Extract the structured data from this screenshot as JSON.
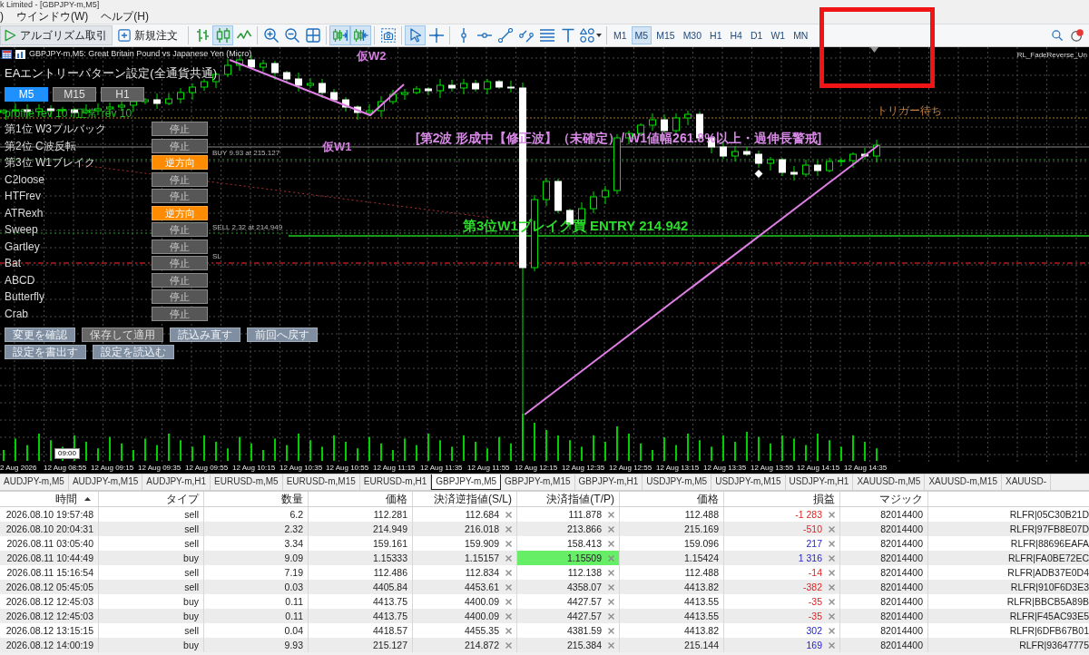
{
  "window": {
    "title": "k Limited - [GBPJPY-m,M5]"
  },
  "menu": [
    ")",
    "ウインドウ(W)",
    "ヘルプ(H)"
  ],
  "toolbar": {
    "buttons": [
      {
        "kind": "algo",
        "label": "アルゴリズム取引"
      },
      {
        "kind": "new-order",
        "label": "新規注文"
      }
    ],
    "tool_groups": [
      [
        {
          "kind": "bars",
          "selected": false
        },
        {
          "kind": "candles",
          "selected": true
        },
        {
          "kind": "line",
          "selected": false
        }
      ],
      [
        {
          "kind": "zoom-in",
          "selected": false
        },
        {
          "kind": "zoom-out",
          "selected": false
        },
        {
          "kind": "tile",
          "selected": false
        }
      ],
      [
        {
          "kind": "auto-scroll",
          "selected": true
        },
        {
          "kind": "chart-shift",
          "selected": true
        }
      ],
      [
        {
          "kind": "screenshot",
          "selected": false
        }
      ],
      [
        {
          "kind": "cursor",
          "selected": true
        },
        {
          "kind": "crosshair",
          "selected": false
        }
      ],
      [
        {
          "kind": "vline",
          "selected": false
        },
        {
          "kind": "hline",
          "selected": false
        },
        {
          "kind": "trendline",
          "selected": false
        },
        {
          "kind": "channel",
          "selected": false
        },
        {
          "kind": "fibo",
          "selected": false
        },
        {
          "kind": "text",
          "selected": false
        },
        {
          "kind": "shapes",
          "selected": false
        }
      ]
    ],
    "timeframes": [
      {
        "label": "M1",
        "selected": false
      },
      {
        "label": "M5",
        "selected": true
      },
      {
        "label": "M15",
        "selected": false
      },
      {
        "label": "M30",
        "selected": false
      },
      {
        "label": "H1",
        "selected": false
      },
      {
        "label": "H4",
        "selected": false
      },
      {
        "label": "D1",
        "selected": false
      },
      {
        "label": "W1",
        "selected": false
      },
      {
        "label": "MN",
        "selected": false
      }
    ]
  },
  "chart": {
    "title": "GBPJPY-m,M5: Great Britain Pound vs Japanese Yen (Micro)",
    "expert": "RL_FadeReverse_Un",
    "wave_labels": [
      "仮W2",
      "仮W1"
    ],
    "wave_status": "[第2波 形成中【修正波】（未確定）/ W1値幅261.8%以上・過伸長警戒]",
    "trigger_label": "トリガー待ち",
    "entry_label": "第3位W1ブレイク買 ENTRY 214.942",
    "level_labels": [
      "BUY 9.93 at 215.127",
      "SELL 2.32 at 214.949",
      "SL"
    ],
    "time_marker": "09:00",
    "time_axis": [
      "2 Aug 2026",
      "12 Aug 08:55",
      "12 Aug 09:15",
      "12 Aug 09:35",
      "12 Aug 09:55",
      "12 Aug 10:15",
      "12 Aug 10:35",
      "12 Aug 10:55",
      "12 Aug 11:15",
      "12 Aug 11:35",
      "12 Aug 11:55",
      "12 Aug 12:15",
      "12 Aug 12:35",
      "12 Aug 12:55",
      "12 Aug 13:15",
      "12 Aug 13:35",
      "12 Aug 13:55",
      "12 Aug 14:15",
      "12 Aug 14:35"
    ],
    "ea_panel": {
      "title": "EAエントリーパターン設定(全通貨共通)",
      "timeframes": [
        {
          "label": "M5",
          "selected": true
        },
        {
          "label": "M15",
          "selected": false
        },
        {
          "label": "H1",
          "selected": false
        }
      ],
      "status": "profile rev 10 / 正常 rev 10",
      "patterns": [
        {
          "name": "第1位 W3プルバック",
          "mode": "停止",
          "active": false
        },
        {
          "name": "第2位 C波反転",
          "mode": "停止",
          "active": false
        },
        {
          "name": "第3位 W1ブレイク",
          "mode": "逆方向",
          "active": true
        },
        {
          "name": "C2loose",
          "mode": "停止",
          "active": false
        },
        {
          "name": "HTFrev",
          "mode": "停止",
          "active": false
        },
        {
          "name": "ATRexh",
          "mode": "逆方向",
          "active": true
        },
        {
          "name": "Sweep",
          "mode": "停止",
          "active": false
        },
        {
          "name": "Gartley",
          "mode": "停止",
          "active": false
        },
        {
          "name": "Bat",
          "mode": "停止",
          "active": false
        },
        {
          "name": "ABCD",
          "mode": "停止",
          "active": false
        },
        {
          "name": "Butterfly",
          "mode": "停止",
          "active": false
        },
        {
          "name": "Crab",
          "mode": "停止",
          "active": false
        }
      ],
      "actions": [
        [
          {
            "label": "変更を確認",
            "kind": "secondary"
          },
          {
            "label": "保存して適用",
            "kind": "primary"
          },
          {
            "label": "読込み直す",
            "kind": "secondary"
          },
          {
            "label": "前回へ戻す",
            "kind": "secondary"
          }
        ],
        [
          {
            "label": "設定を書出す",
            "kind": "secondary"
          },
          {
            "label": "設定を読込む",
            "kind": "secondary"
          }
        ]
      ]
    }
  },
  "chart_tabs": [
    {
      "label": "AUDJPY-m,M5",
      "selected": false
    },
    {
      "label": "AUDJPY-m,M15",
      "selected": false
    },
    {
      "label": "AUDJPY-m,H1",
      "selected": false
    },
    {
      "label": "EURUSD-m,M5",
      "selected": false
    },
    {
      "label": "EURUSD-m,M15",
      "selected": false
    },
    {
      "label": "EURUSD-m,H1",
      "selected": false
    },
    {
      "label": "GBPJPY-m,M5",
      "selected": true
    },
    {
      "label": "GBPJPY-m,M15",
      "selected": false
    },
    {
      "label": "GBPJPY-m,H1",
      "selected": false
    },
    {
      "label": "USDJPY-m,M5",
      "selected": false
    },
    {
      "label": "USDJPY-m,M15",
      "selected": false
    },
    {
      "label": "USDJPY-m,H1",
      "selected": false
    },
    {
      "label": "XAUUSD-m,M5",
      "selected": false
    },
    {
      "label": "XAUUSD-m,M15",
      "selected": false
    },
    {
      "label": "XAUUSD-",
      "selected": false
    }
  ],
  "trade_table": {
    "columns": [
      "時間",
      "タイプ",
      "数量",
      "価格",
      "決済逆指値(S/L)",
      "決済指値(T/P)",
      "価格",
      "損益",
      "マジック"
    ],
    "rows": [
      {
        "time": "2026.08.10 19:57:48",
        "type": "sell",
        "volume": "6.2",
        "price": "112.281",
        "sl": "112.684",
        "tp": "111.878",
        "current_price": "112.488",
        "profit": "-1 283",
        "magic": "82014400",
        "column_10": "RLFR|05C30B21D",
        "loss": true,
        "tp_highlighted": false
      },
      {
        "time": "2026.08.10 20:04:31",
        "type": "sell",
        "volume": "2.32",
        "price": "214.949",
        "sl": "216.018",
        "tp": "213.866",
        "current_price": "215.169",
        "profit": "-510",
        "magic": "82014400",
        "column_10": "RLFR|97FB8E07D",
        "loss": true,
        "tp_highlighted": false
      },
      {
        "time": "2026.08.11 03:05:40",
        "type": "sell",
        "volume": "3.34",
        "price": "159.161",
        "sl": "159.909",
        "tp": "158.413",
        "current_price": "159.096",
        "profit": "217",
        "magic": "82014400",
        "column_10": "RLFR|88696EAFA",
        "loss": false,
        "tp_highlighted": false
      },
      {
        "time": "2026.08.11 10:44:49",
        "type": "buy",
        "volume": "9.09",
        "price": "1.15333",
        "sl": "1.15157",
        "tp": "1.15509",
        "current_price": "1.15424",
        "profit": "1 316",
        "magic": "82014400",
        "column_10": "RLFR|FA0BE72EC",
        "loss": false,
        "tp_highlighted": true
      },
      {
        "time": "2026.08.11 15:16:54",
        "type": "sell",
        "volume": "7.19",
        "price": "112.486",
        "sl": "112.834",
        "tp": "112.138",
        "current_price": "112.488",
        "profit": "-14",
        "magic": "82014400",
        "column_10": "RLFR|ADB37E0D4",
        "loss": true,
        "tp_highlighted": false
      },
      {
        "time": "2026.08.12 05:45:05",
        "type": "sell",
        "volume": "0.03",
        "price": "4405.84",
        "sl": "4453.61",
        "tp": "4358.07",
        "current_price": "4413.82",
        "profit": "-382",
        "magic": "82014400",
        "column_10": "RLFR|910F6D3E3",
        "loss": true,
        "tp_highlighted": false
      },
      {
        "time": "2026.08.12 12:45:03",
        "type": "buy",
        "volume": "0.11",
        "price": "4413.75",
        "sl": "4400.09",
        "tp": "4427.57",
        "current_price": "4413.55",
        "profit": "-35",
        "magic": "82014400",
        "column_10": "RLFR|BBCB5A89B",
        "loss": true,
        "tp_highlighted": false
      },
      {
        "time": "2026.08.12 12:45:03",
        "type": "buy",
        "volume": "0.11",
        "price": "4413.75",
        "sl": "4400.09",
        "tp": "4427.57",
        "current_price": "4413.55",
        "profit": "-35",
        "magic": "82014400",
        "column_10": "RLFR|F45AC93E5",
        "loss": true,
        "tp_highlighted": false
      },
      {
        "time": "2026.08.12 13:15:15",
        "type": "sell",
        "volume": "0.04",
        "price": "4418.57",
        "sl": "4455.35",
        "tp": "4381.59",
        "current_price": "4413.82",
        "profit": "302",
        "magic": "82014400",
        "column_10": "RLFR|6DFB67B01",
        "loss": false,
        "tp_highlighted": false
      },
      {
        "time": "2026.08.12 14:00:19",
        "type": "buy",
        "volume": "9.93",
        "price": "215.127",
        "sl": "214.872",
        "tp": "215.384",
        "current_price": "215.144",
        "profit": "169",
        "magic": "82014400",
        "column_10": "RLFR|93647775",
        "loss": false,
        "tp_highlighted": false
      }
    ]
  },
  "annotations": [
    {
      "kind": "highlight-box"
    }
  ]
}
